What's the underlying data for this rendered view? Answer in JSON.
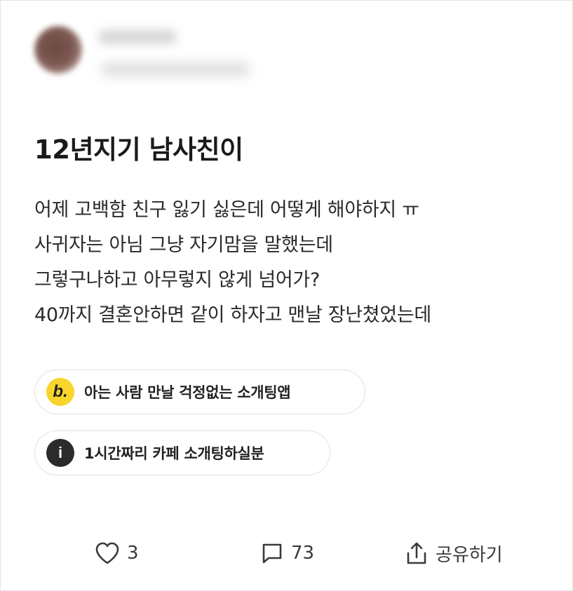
{
  "post": {
    "title": "12년지기 남사친이",
    "body_lines": [
      "어제 고백함 친구 잃기 싫은데 어떻게 해야하지 ㅠ",
      "사귀자는 아님 그냥 자기맘을 말했는데",
      "그렇구나하고 아무렇지 않게 넘어가?",
      "40까지 결혼안하면 같이 하자고 맨날 장난쳤었는데"
    ]
  },
  "links": [
    {
      "icon": "brand-b-icon",
      "icon_glyph": "b.",
      "label": "아는 사람 만날 걱정없는 소개팅앱"
    },
    {
      "icon": "info-icon",
      "icon_glyph": "i",
      "label": "1시간짜리 카페 소개팅하실분"
    }
  ],
  "actions": {
    "like_count": "3",
    "comment_count": "73",
    "share_label": "공유하기"
  },
  "colors": {
    "brand_yellow": "#f9d52b",
    "info_dark": "#2b2b2b",
    "text": "#1f1f1f"
  }
}
